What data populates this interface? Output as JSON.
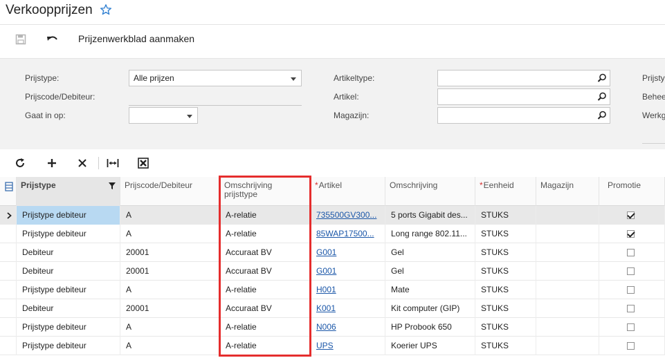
{
  "header": {
    "title": "Verkoopprijzen"
  },
  "toolbar": {
    "create_worksheet_label": "Prijzenwerkblad aanmaken"
  },
  "filters": {
    "price_type_label": "Prijstype:",
    "price_type_value": "Alle prijzen",
    "price_code_label": "Prijscode/Debiteur:",
    "effective_label": "Gaat in op:",
    "item_type_label": "Artikeltype:",
    "item_label": "Artikel:",
    "warehouse_label": "Magazijn:",
    "right_truncated_1": "Prijsty",
    "right_truncated_2": "Behee",
    "right_truncated_3": "Werkg"
  },
  "columns": {
    "price_type": "Prijstype",
    "price_code": "Prijscode/Debiteur",
    "description_line1": "Omschrijving",
    "description_line2": "prijsttype",
    "item": "Artikel",
    "item_description": "Omschrijving",
    "uom": "Eenheid",
    "warehouse": "Magazijn",
    "promotion": "Promotie"
  },
  "rows": [
    {
      "price_type": "Prijstype debiteur",
      "price_code": "A",
      "description": "A-relatie",
      "item": "735500GV300...",
      "item_description": "5 ports Gigabit des...",
      "uom": "STUKS",
      "warehouse": "",
      "promotion": true
    },
    {
      "price_type": "Prijstype debiteur",
      "price_code": "A",
      "description": "A-relatie",
      "item": "85WAP17500...",
      "item_description": "Long range 802.11...",
      "uom": "STUKS",
      "warehouse": "",
      "promotion": true
    },
    {
      "price_type": "Debiteur",
      "price_code": "20001",
      "description": "Accuraat BV",
      "item": "G001",
      "item_description": "Gel",
      "uom": "STUKS",
      "warehouse": "",
      "promotion": false
    },
    {
      "price_type": "Debiteur",
      "price_code": "20001",
      "description": "Accuraat BV",
      "item": "G001",
      "item_description": "Gel",
      "uom": "STUKS",
      "warehouse": "",
      "promotion": false
    },
    {
      "price_type": "Prijstype debiteur",
      "price_code": "A",
      "description": "A-relatie",
      "item": "H001",
      "item_description": "Mate",
      "uom": "STUKS",
      "warehouse": "",
      "promotion": false
    },
    {
      "price_type": "Debiteur",
      "price_code": "20001",
      "description": "Accuraat BV",
      "item": "K001",
      "item_description": "Kit computer (GIP)",
      "uom": "STUKS",
      "warehouse": "",
      "promotion": false
    },
    {
      "price_type": "Prijstype debiteur",
      "price_code": "A",
      "description": "A-relatie",
      "item": "N006",
      "item_description": "HP Probook 650",
      "uom": "STUKS",
      "warehouse": "",
      "promotion": false
    },
    {
      "price_type": "Prijstype debiteur",
      "price_code": "A",
      "description": "A-relatie",
      "item": "UPS",
      "item_description": "Koerier UPS",
      "uom": "STUKS",
      "warehouse": "",
      "promotion": false
    }
  ],
  "icons": {
    "favorite": "star-outline-icon",
    "save": "save-icon",
    "undo": "undo-icon",
    "refresh": "refresh-icon",
    "add": "plus-icon",
    "delete": "close-icon",
    "fit": "fit-columns-icon",
    "export": "excel-export-icon"
  },
  "colors": {
    "accent": "#1a56a8",
    "highlight_border": "#e52d2d",
    "selected_cell": "#b8d9f2"
  }
}
